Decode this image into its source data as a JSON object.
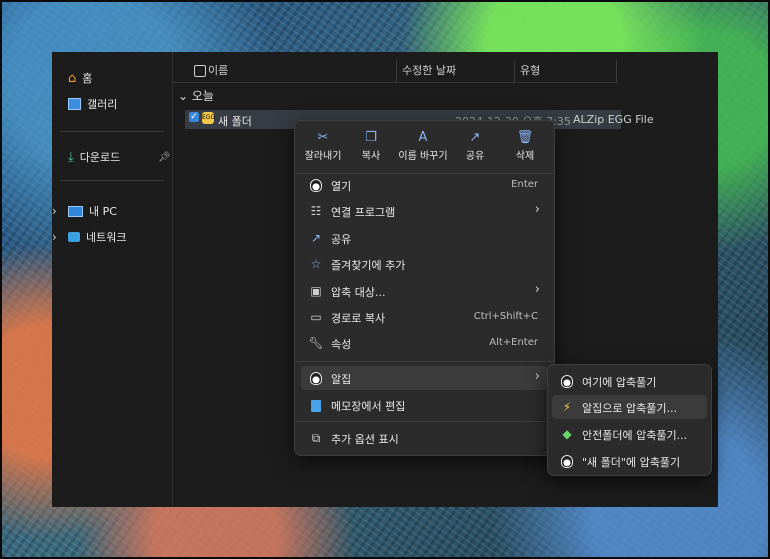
{
  "sidebar": {
    "home": "홈",
    "gallery": "갤러리",
    "downloads": "다운로드",
    "this_pc": "내 PC",
    "network": "네트워크"
  },
  "columns": {
    "name": "이름",
    "date": "수정한 날짜",
    "type": "유형"
  },
  "group": "오늘",
  "file": {
    "name": "새 폴더",
    "date": "2024-12-30 오후 7:35",
    "type": "ALZip EGG File"
  },
  "toolbar": {
    "cut": "잘라내기",
    "copy": "복사",
    "rename": "이름 바꾸기",
    "share": "공유",
    "delete": "삭제"
  },
  "menu": [
    {
      "label": "열기",
      "shortcut": "Enter"
    },
    {
      "label": "연결 프로그램",
      "shortcut": ""
    },
    {
      "label": "공유",
      "shortcut": ""
    },
    {
      "label": "즐겨찾기에 추가",
      "shortcut": ""
    },
    {
      "label": "압축 대상...",
      "shortcut": ""
    },
    {
      "label": "경로로 복사",
      "shortcut": "Ctrl+Shift+C"
    },
    {
      "label": "속성",
      "shortcut": "Alt+Enter"
    },
    {
      "label": "알집",
      "shortcut": ""
    },
    {
      "label": "메모장에서 편집",
      "shortcut": ""
    },
    {
      "label": "추가 옵션 표시",
      "shortcut": ""
    }
  ],
  "submenu": [
    {
      "label": "여기에 압축풀기"
    },
    {
      "label": "알집으로 압축풀기..."
    },
    {
      "label": "안전폴더에 압축풀기..."
    },
    {
      "label": "\"새 폴더\"에 압축풀기"
    }
  ],
  "colors": {
    "accent": "#8ab4f8",
    "selected_row": "#373c44",
    "menu_bg": "#2b2b2b"
  }
}
